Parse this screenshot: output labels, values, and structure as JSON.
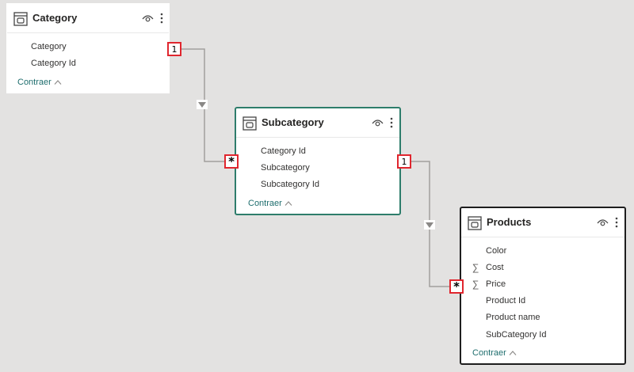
{
  "tables": {
    "category": {
      "title": "Category",
      "fields": [
        "Category",
        "Category Id"
      ],
      "collapse_label": "Contraer"
    },
    "subcategory": {
      "title": "Subcategory",
      "fields": [
        "Category Id",
        "Subcategory",
        "Subcategory Id"
      ],
      "collapse_label": "Contraer"
    },
    "products": {
      "title": "Products",
      "fields": [
        "Color",
        "Cost",
        "Price",
        "Product Id",
        "Product name",
        "SubCategory Id"
      ],
      "measure_fields": [
        "Cost",
        "Price"
      ],
      "collapse_label": "Contraer"
    }
  },
  "relationships": {
    "category_subcategory": {
      "one_label": "1",
      "many_label": "*"
    },
    "subcategory_products": {
      "one_label": "1",
      "many_label": "*"
    }
  },
  "icons": {
    "table": "table-icon",
    "visibility": "eye-icon",
    "more": "more-options-icon",
    "measure": "sigma-icon",
    "collapse": "chevron-up-icon",
    "filter_direction": "filter-arrow-down-icon"
  },
  "colors": {
    "selected_border": "#2e7d6b",
    "active_border": "#1e1e1e",
    "cardinality_border": "#e0262e",
    "link_text": "#1f6e6e",
    "canvas_bg": "#e3e2e1"
  }
}
